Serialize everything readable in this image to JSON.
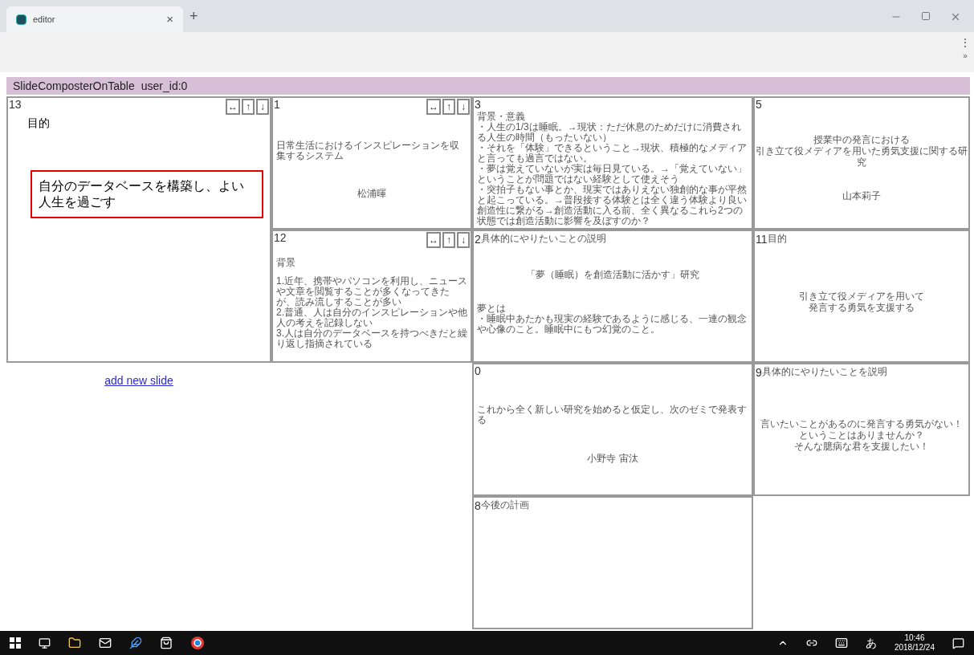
{
  "browser": {
    "tab": {
      "title": "editor",
      "close": "×",
      "selected": true
    },
    "new_tab": "+",
    "toolbar": {
      "menu": "⋮",
      "more": "»"
    }
  },
  "header": {
    "app": "SlideComposterOnTable",
    "user": "user_id:0"
  },
  "columns": [
    {
      "slides": [
        {
          "number": "13",
          "kind": "large",
          "controls": [
            "↔",
            "↑",
            "↓"
          ],
          "blocks": [
            {
              "kind": "heading",
              "text": "目的"
            },
            {
              "kind": "textbox",
              "text": "自分のデータベースを構築し、よい人生を過ごす",
              "selected": true
            }
          ]
        }
      ],
      "add_link": "add new slide"
    },
    {
      "slides": [
        {
          "number": "1",
          "kind": "small",
          "controls": [
            "↔",
            "↑",
            "↓"
          ],
          "blocks": [
            {
              "kind": "left",
              "lines": [
                "日常生活におけるインスピレーションを収集するシステム"
              ]
            },
            {
              "kind": "center",
              "lines": [
                "松浦暉"
              ]
            }
          ]
        },
        {
          "number": "12",
          "kind": "small",
          "controls": [
            "↔",
            "↑",
            "↓"
          ],
          "blocks": [
            {
              "kind": "heading",
              "text": "背景"
            },
            {
              "kind": "left",
              "lines": [
                "1.近年、携帯やパソコンを利用し、ニュースや文章を閲覧することが多くなってきたが、読み流しすることが多い",
                "2.普通、人は自分のインスピレーションや他人の考えを記録しない",
                "3.人は自分のデータベースを持つべきだと繰り返し指摘されている"
              ]
            }
          ]
        }
      ]
    },
    {
      "slides": [
        {
          "number": "3",
          "kind": "small",
          "blocks": [
            {
              "kind": "heading",
              "text": "背景・意義"
            },
            {
              "kind": "left",
              "lines": [
                "・人生の1/3は睡眠。→現状：ただ休息のためだけに消費される人生の時間（もったいない）",
                "・それを「体験」できるということ→現状、積極的なメディアと言っても過言ではない。",
                "・夢は覚えていないが実は毎日見ている。→「覚えていない」ということが問題ではない経験として使えそう",
                "・突拍子もない事とか、現実ではありえない独創的な事が平然と起こっている。→普段接する体験とは全く違う体験より良い創造性に繋がる→創造活動に入る前、全く異なるこれら2つの状態では創造活動に影響を及ぼすのか？"
              ]
            }
          ]
        },
        {
          "number": "2",
          "kind": "small",
          "title": "具体的にやりたいことの説明",
          "blocks": [
            {
              "kind": "center",
              "lines": [
                "「夢（睡眠）を創造活動に活かす」研究"
              ]
            },
            {
              "kind": "left",
              "lines": [
                "夢とは",
                "・睡眠中あたかも現実の経験であるように感じる、一連の観念や心像のこと。睡眠中にもつ幻覚のこと。"
              ]
            }
          ]
        },
        {
          "number": "0",
          "kind": "small",
          "blocks": [
            {
              "kind": "left",
              "lines": [
                "これから全く新しい研究を始めると仮定し、次のゼミで発表する"
              ]
            },
            {
              "kind": "center",
              "lines": [
                "小野寺 宙汰"
              ]
            }
          ]
        },
        {
          "number": "8",
          "kind": "small",
          "title": "今後の計画"
        }
      ]
    },
    {
      "slides": [
        {
          "number": "5",
          "kind": "small",
          "blocks": [
            {
              "kind": "center",
              "lines": [
                "授業中の発言における",
                "引き立て役メディアを用いた勇気支援に関する研究"
              ]
            },
            {
              "kind": "center",
              "lines": [
                "山本莉子"
              ]
            }
          ]
        },
        {
          "number": "11",
          "kind": "small",
          "title": "目的",
          "blocks": [
            {
              "kind": "center",
              "lines": [
                "引き立て役メディアを用いて",
                "発言する勇気を支援する"
              ]
            }
          ]
        },
        {
          "number": "9",
          "kind": "small",
          "title": "具体的にやりたいことを説明",
          "blocks": [
            {
              "kind": "center",
              "lines": [
                "言いたいことがあるのに発言する勇気がない！",
                "ということはありませんか？",
                "そんな臆病な君を支援したい！"
              ]
            }
          ]
        }
      ]
    }
  ],
  "taskbar": {
    "ime": "あ",
    "time": "10:46",
    "date": "2018/12/24"
  }
}
